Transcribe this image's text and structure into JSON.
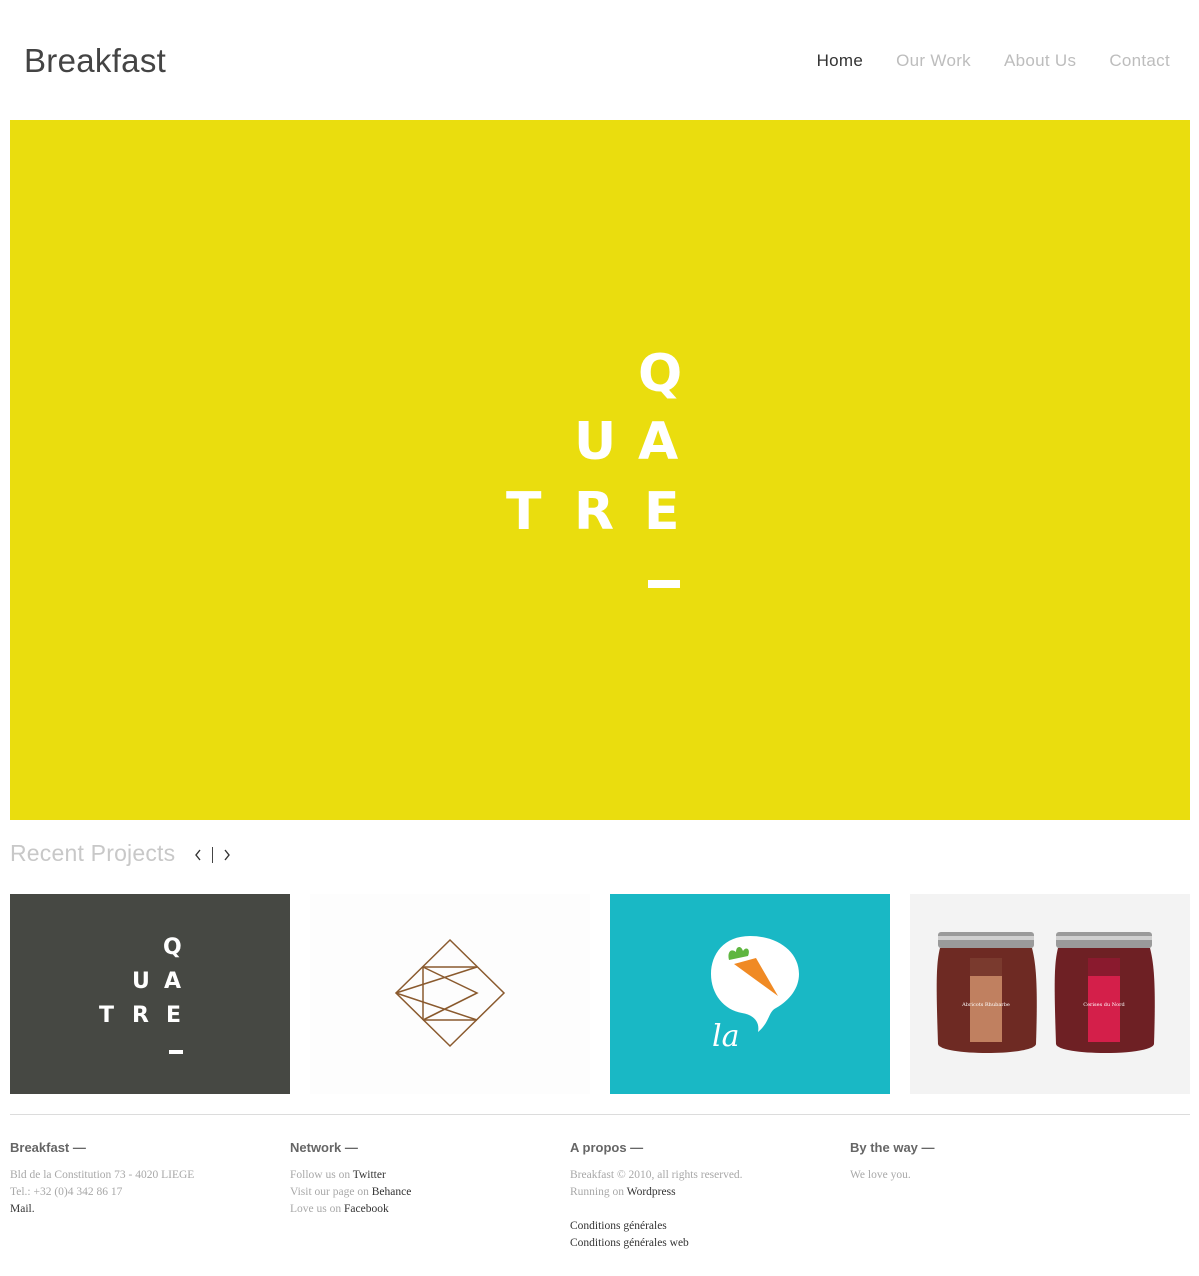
{
  "header": {
    "brand": "Breakfast",
    "nav": [
      {
        "label": "Home"
      },
      {
        "label": "Our Work"
      },
      {
        "label": "About Us"
      },
      {
        "label": "Contact"
      }
    ]
  },
  "hero": {
    "background": "#eadd0e",
    "letters": [
      "Q",
      "U",
      "A",
      "T",
      "R",
      "E"
    ]
  },
  "recent": {
    "title": "Recent Projects",
    "prev_icon": "chevron-left-icon",
    "next_icon": "chevron-right-icon",
    "projects": [
      {
        "name": "quatre-logo",
        "background": "#464843",
        "letters": [
          "Q",
          "U",
          "A",
          "T",
          "R",
          "E"
        ]
      },
      {
        "name": "geometric-logo",
        "background": "#fdfdfd"
      },
      {
        "name": "la-carrot-logo",
        "background": "#19b8c5",
        "text": "la"
      },
      {
        "name": "jam-jars",
        "background": "#f3f3f3",
        "labels": [
          "Abricots Rhubarbe",
          "Cerises du Nord"
        ]
      }
    ]
  },
  "footer": {
    "col1": {
      "title": "Breakfast —",
      "address": "Bld de la Constitution 73 - 4020 LIEGE",
      "tel": "Tel.: +32 (0)4 342 86 17",
      "mail": "Mail",
      "mail_suffix": "."
    },
    "col2": {
      "title": "Network —",
      "twitter_prefix": "Follow us on ",
      "twitter": "Twitter",
      "behance_prefix": "Visit our page on ",
      "behance": "Behance",
      "facebook_prefix": "Love us on ",
      "facebook": "Facebook"
    },
    "col3": {
      "title": "A propos —",
      "copyright": "Breakfast © 2010, all rights reserved.",
      "running_prefix": "Running on ",
      "wordpress": "Wordpress",
      "cgv": "Conditions générales",
      "cgv_web": "Conditions générales web"
    },
    "col4": {
      "title": "By the way —",
      "text": "We love you."
    }
  }
}
